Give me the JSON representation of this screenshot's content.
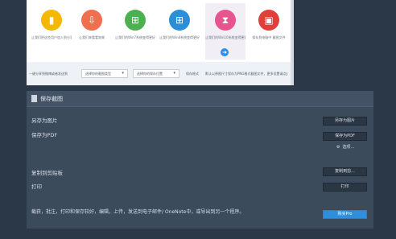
{
  "preview": {
    "apps": [
      {
        "label": "让我们把这些用户加入到分享"
      },
      {
        "label": "让我们来看看效果"
      },
      {
        "label": "让我们的Win7系统变得更好"
      },
      {
        "label": "让我们的Win8系统变得更好"
      },
      {
        "label": "让我们的Win10系统变得更好"
      },
      {
        "label": "保存到电脑中 截图文件"
      }
    ],
    "options": {
      "left_text": "一键分享到微博或者发送到",
      "dropdown1": "选择你的截图类型",
      "dropdown2": "选择你的保存位置",
      "label2": "保存格式",
      "right_text": "默认以原图尺寸保存为PNG格式截图文件，更多设置请点此"
    },
    "colors": {
      "app_icon_1": "#f5b800",
      "app_icon_2": "#ef6f4f",
      "app_icon_3": "#4cb050",
      "app_icon_4": "#2a8fd6",
      "app_icon_5": "#e8548e",
      "app_icon_6": "#e0403a"
    }
  },
  "panel": {
    "title": "保存截图",
    "rows": {
      "save_image_label": "另存为图片",
      "save_pdf_label": "保存为PDF",
      "clipboard_label": "复制到剪贴板",
      "print_label": "打印"
    },
    "buttons": {
      "save_image": "另存为图片",
      "save_pdf": "保存为PDF",
      "settings_link": "选项...",
      "clipboard": "复制到剪...",
      "print": "打印",
      "pro": "购买Pro"
    },
    "description": "截获，批注，打印和保存较好，编辑，上传，发送到电子邮件/ OneNote中，或导出到另一个程序。"
  }
}
